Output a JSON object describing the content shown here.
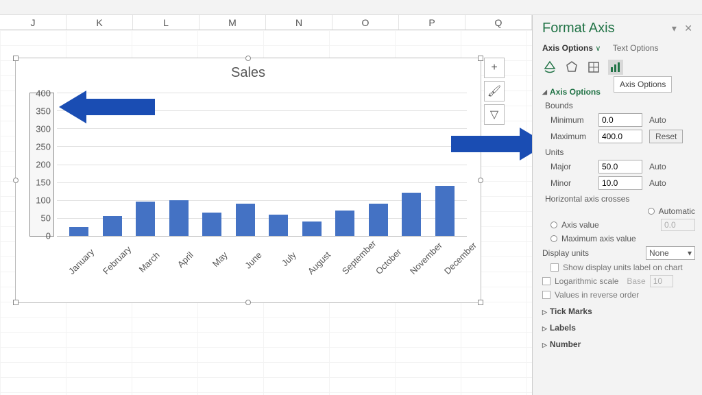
{
  "columns": [
    "J",
    "K",
    "L",
    "M",
    "N",
    "O",
    "P",
    "Q"
  ],
  "chart_data": {
    "type": "bar",
    "title": "Sales",
    "categories": [
      "January",
      "February",
      "March",
      "April",
      "May",
      "June",
      "July",
      "August",
      "September",
      "October",
      "November",
      "December"
    ],
    "values": [
      25,
      55,
      95,
      100,
      65,
      90,
      60,
      40,
      70,
      90,
      120,
      140
    ],
    "ylim": [
      0,
      400
    ],
    "ytick_step": 50,
    "yticks": [
      400,
      350,
      300,
      250,
      200,
      150,
      100,
      50,
      0
    ]
  },
  "chart_buttons": {
    "plus": "+",
    "brush": "🖌",
    "filter": "▽"
  },
  "pane": {
    "title": "Format Axis",
    "menu_glyph": "▾",
    "close_glyph": "✕",
    "tab_options": "Axis Options",
    "tab_text": "Text Options",
    "chevron": "∨",
    "tooltip": "Axis Options",
    "section_axis_options": "Axis Options",
    "bounds": {
      "label": "Bounds",
      "min_label": "Minimum",
      "min_value": "0.0",
      "min_auto": "Auto",
      "max_label": "Maximum",
      "max_value": "400.0",
      "max_reset": "Reset"
    },
    "units": {
      "label": "Units",
      "major_label": "Major",
      "major_value": "50.0",
      "major_auto": "Auto",
      "minor_label": "Minor",
      "minor_value": "10.0",
      "minor_auto": "Auto"
    },
    "hcross": {
      "label": "Horizontal axis crosses",
      "auto": "Automatic",
      "axis_value": "Axis value",
      "axis_value_input": "0.0",
      "max_axis": "Maximum axis value"
    },
    "display_units": {
      "label": "Display units",
      "value": "None",
      "show_label": "Show display units label on chart"
    },
    "log": {
      "label": "Logarithmic scale",
      "base_label": "Base",
      "base_value": "10"
    },
    "reverse": "Values in reverse order",
    "tick_marks": "Tick Marks",
    "labels": "Labels",
    "number": "Number"
  },
  "colors": {
    "bar": "#4472c4",
    "accent": "#217346",
    "arrow": "#1a4db3"
  }
}
